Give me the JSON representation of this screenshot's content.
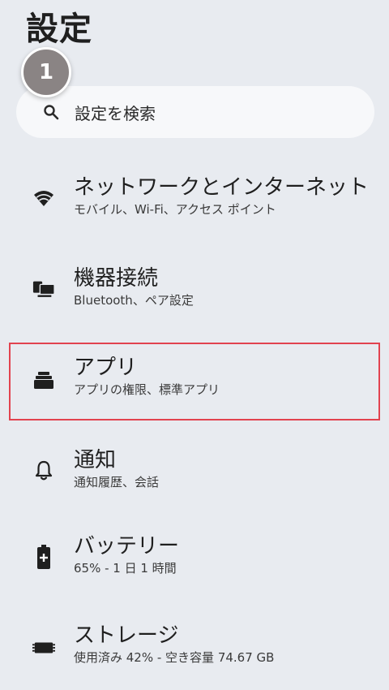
{
  "page": {
    "title": "設定"
  },
  "step_badge": {
    "number": "1"
  },
  "search": {
    "placeholder": "設定を検索",
    "icon": "search-icon"
  },
  "items": [
    {
      "title": "ネットワークとインターネット",
      "subtitle": "モバイル、Wi-Fi、アクセス ポイント",
      "icon": "wifi-icon"
    },
    {
      "title": "機器接続",
      "subtitle": "Bluetooth、ペア設定",
      "icon": "connected-devices-icon"
    },
    {
      "title": "アプリ",
      "subtitle": "アプリの権限、標準アプリ",
      "icon": "apps-icon"
    },
    {
      "title": "通知",
      "subtitle": "通知履歴、会話",
      "icon": "bell-icon"
    },
    {
      "title": "バッテリー",
      "subtitle": "65% - 1 日 1 時間",
      "icon": "battery-icon"
    },
    {
      "title": "ストレージ",
      "subtitle": "使用済み 42% - 空き容量 74.67 GB",
      "icon": "storage-icon"
    }
  ],
  "colors": {
    "background": "#e8ebf0",
    "highlight": "#e2434f",
    "badge": "#8a8484"
  }
}
